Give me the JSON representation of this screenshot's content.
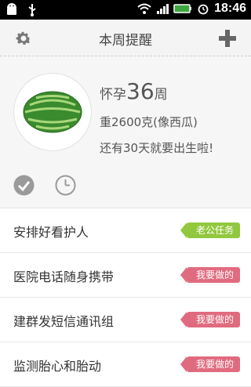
{
  "statusbar": {
    "time": "18:46",
    "icons": [
      "android-icon",
      "usb-icon",
      "wifi-icon",
      "signal-icon",
      "battery-icon",
      "alarm-icon"
    ]
  },
  "header": {
    "title": "本周提醒",
    "left_icon": "gear-icon",
    "right_icon": "plus-icon"
  },
  "hero": {
    "week_prefix": "怀孕",
    "week_number": "36",
    "week_suffix": "周",
    "weight_line": "重2600克(像西瓜)",
    "countdown_line": "还有30天就要出生啦!",
    "image": "watermelon"
  },
  "actions": {
    "check_icon": "check-icon",
    "clock_icon": "clock-icon"
  },
  "tasks": [
    {
      "label": "安排好看护人",
      "tag": "老公任务",
      "tag_color": "#92c83e"
    },
    {
      "label": "医院电话随身携带",
      "tag": "我要做的",
      "tag_color": "#e06b7f"
    },
    {
      "label": "建群发短信通讯组",
      "tag": "我要做的",
      "tag_color": "#e06b7f"
    },
    {
      "label": "监测胎心和胎动",
      "tag": "我要做的",
      "tag_color": "#e06b7f"
    }
  ]
}
